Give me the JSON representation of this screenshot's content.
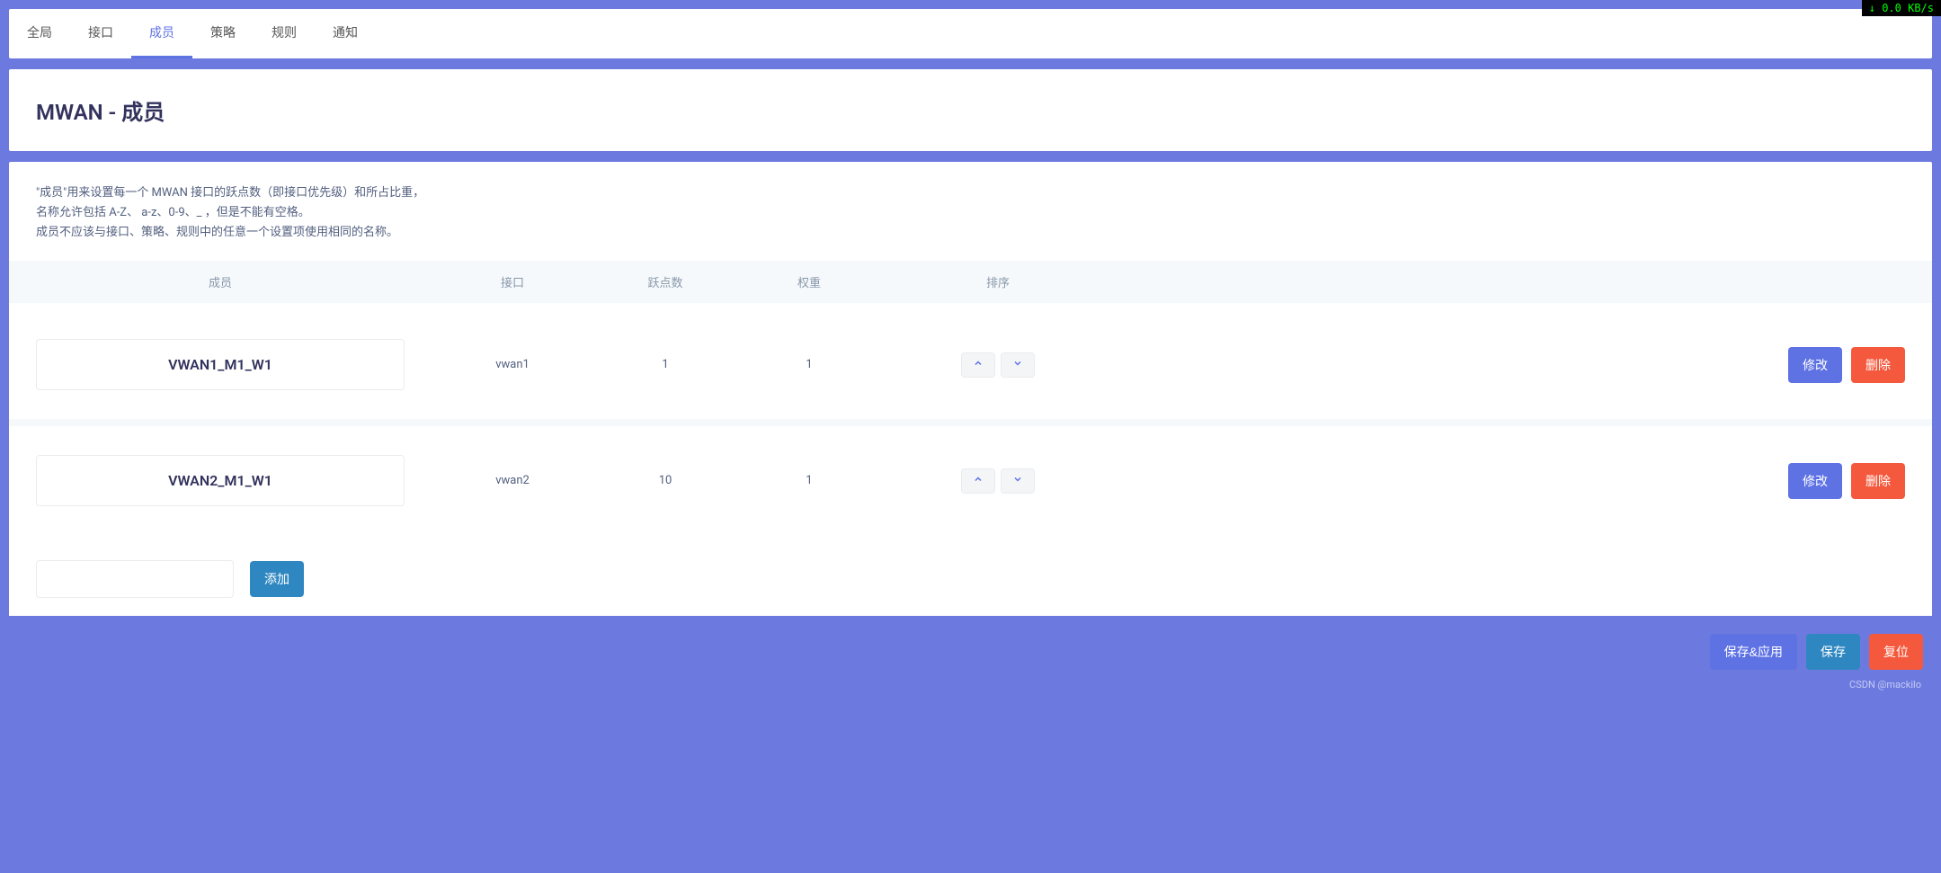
{
  "speed": "↓ 0.0 KB/s",
  "tabs": [
    "全局",
    "接口",
    "成员",
    "策略",
    "规则",
    "通知"
  ],
  "activeTab": 2,
  "pageTitle": "MWAN - 成员",
  "description": {
    "line1": "\"成员\"用来设置每一个 MWAN 接口的跃点数（即接口优先级）和所占比重，",
    "line2": "名称允许包括 A-Z、 a-z、0-9、_ ，但是不能有空格。",
    "line3": "成员不应该与接口、策略、规则中的任意一个设置项使用相同的名称。"
  },
  "columns": {
    "name": "成员",
    "iface": "接口",
    "hop": "跃点数",
    "weight": "权重",
    "sort": "排序"
  },
  "rows": [
    {
      "name": "VWAN1_M1_W1",
      "iface": "vwan1",
      "hop": "1",
      "weight": "1"
    },
    {
      "name": "VWAN2_M1_W1",
      "iface": "vwan2",
      "hop": "10",
      "weight": "1"
    }
  ],
  "buttons": {
    "edit": "修改",
    "delete": "删除",
    "add": "添加",
    "saveApply": "保存&应用",
    "save": "保存",
    "reset": "复位"
  },
  "watermark": "CSDN @mackilo"
}
